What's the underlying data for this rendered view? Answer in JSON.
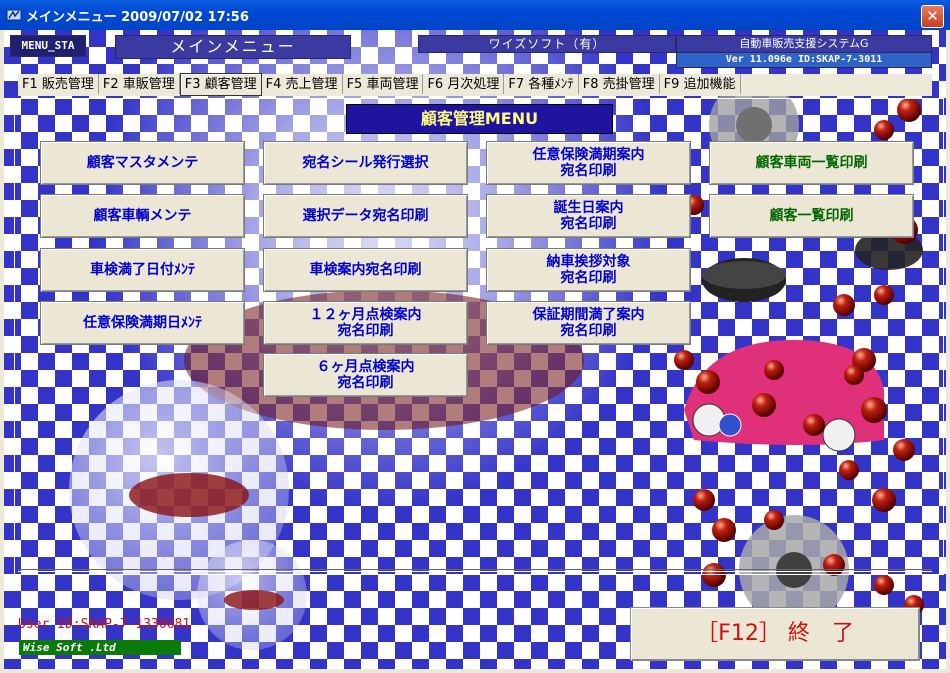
{
  "window": {
    "title": "メインメニュー  2009/07/02 17:56",
    "close_label": "✕"
  },
  "header": {
    "menu_sta": "MENU_STA",
    "main_title": "メインメニュー",
    "company": "ワイズソフト（有）",
    "system_name": "自動車販売支援システムG",
    "version": "Ver 11.096e  ID:SKAP-7-3011"
  },
  "tabs": [
    {
      "label": "F1 販売管理"
    },
    {
      "label": "F2 車販管理"
    },
    {
      "label": "F3 顧客管理"
    },
    {
      "label": "F4 売上管理"
    },
    {
      "label": "F5 車両管理"
    },
    {
      "label": "F6 月次処理"
    },
    {
      "label": "F7 各種ﾒﾝﾃ"
    },
    {
      "label": "F8 売掛管理"
    },
    {
      "label": "F9 追加機能"
    }
  ],
  "active_tab": "F3 顧客管理",
  "panel": {
    "title": "顧客管理MENU"
  },
  "buttons": {
    "c1": [
      "顧客マスタメンテ",
      "顧客車輌メンテ",
      "車検満了日付ﾒﾝﾃ",
      "任意保険満期日ﾒﾝﾃ"
    ],
    "c2": [
      "宛名シール発行選択",
      "選択データ宛名印刷",
      "車検案内宛名印刷",
      "１２ヶ月点検案内\n宛名印刷",
      "６ヶ月点検案内\n宛名印刷"
    ],
    "c3": [
      "任意保険満期案内\n宛名印刷",
      "誕生日案内\n宛名印刷",
      "納車挨拶対象\n宛名印刷",
      "保証期間満了案内\n宛名印刷"
    ],
    "c4": [
      "顧客車両一覧印刷",
      "顧客一覧印刷"
    ]
  },
  "footer": {
    "user_id": "User ID:SKAP-7-1330681",
    "brand": "Wise Soft .Ltd",
    "exit_label": "［F12］ 終　了"
  },
  "colors": {
    "title_bar": "#0049d4",
    "panel_title_bg": "#1e14a0",
    "panel_title_text": "#fffc80",
    "button_text_blue": "#0000cc",
    "button_text_green": "#006600",
    "exit_text": "#d01010"
  }
}
